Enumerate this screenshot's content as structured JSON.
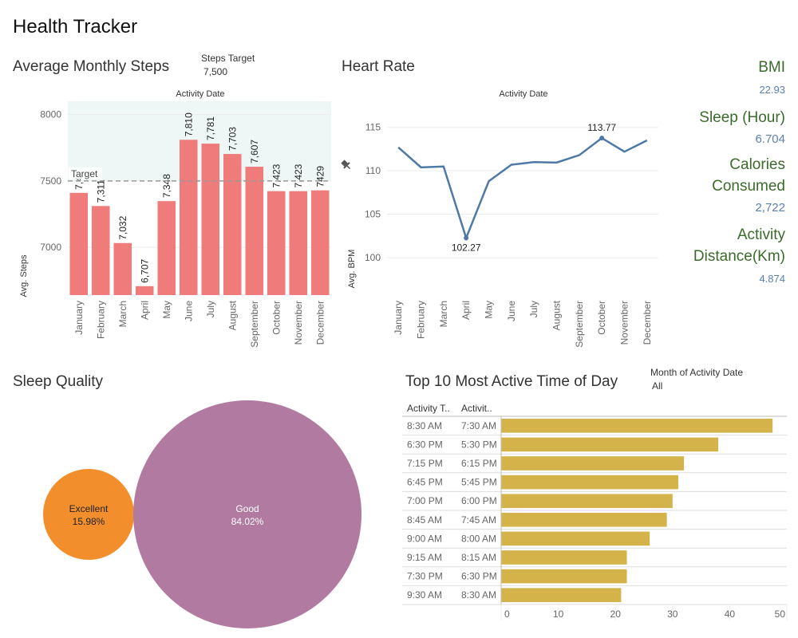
{
  "page_title": "Health Tracker",
  "steps": {
    "title": "Average Monthly Steps",
    "target_label": "Steps Target",
    "target_value": "7,500",
    "header": "Activity Date",
    "y_title": "Avg. Steps",
    "target_line_label": "Target",
    "bar_color": "#ef7b7b",
    "band_color": "#eef7f6"
  },
  "heart": {
    "title": "Heart Rate",
    "header": "Activity Date",
    "y_title": "Avg. BPM",
    "line_color": "#4e79a7"
  },
  "kpis": [
    {
      "label_lines": [
        "BMI"
      ],
      "value": "22.93"
    },
    {
      "label_lines": [
        "Sleep (Hour)"
      ],
      "value": "6.704"
    },
    {
      "label_lines": [
        "Calories",
        "Consumed"
      ],
      "value": "2,722"
    },
    {
      "label_lines": [
        "Activity",
        "Distance(Km)"
      ],
      "value": "4.874"
    }
  ],
  "sleep": {
    "title": "Sleep Quality",
    "circles": [
      {
        "label": "Excellent",
        "pct": "15.98%",
        "color": "#f28e2b"
      },
      {
        "label": "Good",
        "pct": "84.02%",
        "color": "#b07aa1"
      }
    ]
  },
  "active": {
    "title": "Top 10 Most Active Time of Day",
    "filter_label": "Month of Activity Date",
    "filter_value": "All",
    "col1": "Activity T..",
    "col2": "Activit..",
    "bar_color": "#d4b44a"
  },
  "chart_data": [
    {
      "type": "bar",
      "title": "Average Monthly Steps",
      "xlabel": "Activity Date",
      "ylabel": "Avg. Steps",
      "categories": [
        "January",
        "February",
        "March",
        "April",
        "May",
        "June",
        "July",
        "August",
        "September",
        "October",
        "November",
        "December"
      ],
      "values": [
        7410,
        7311,
        7032,
        6707,
        7348,
        7810,
        7781,
        7703,
        7607,
        7423,
        7423,
        7429
      ],
      "labels": [
        "7,4..",
        "7,311",
        "7,032",
        "6,707",
        "7,348",
        "7,810",
        "7,781",
        "7,703",
        "7,607",
        "7,423",
        "7,423",
        "7429"
      ],
      "yticks": [
        7000,
        7500,
        8000
      ],
      "ylim": [
        6640,
        8100
      ],
      "reference_line": 7500,
      "reference_band": [
        7500,
        8100
      ]
    },
    {
      "type": "line",
      "title": "Heart Rate",
      "xlabel": "Activity Date",
      "ylabel": "Avg. BPM",
      "categories": [
        "January",
        "February",
        "March",
        "April",
        "May",
        "June",
        "July",
        "August",
        "September",
        "October",
        "November",
        "December"
      ],
      "values": [
        112.7,
        110.4,
        110.5,
        102.27,
        108.8,
        110.7,
        111.0,
        110.95,
        111.8,
        113.77,
        112.2,
        113.5
      ],
      "annotations": [
        {
          "index": 3,
          "text": "102.27"
        },
        {
          "index": 9,
          "text": "113.77"
        }
      ],
      "yticks": [
        100,
        105,
        110,
        115
      ],
      "ylim": [
        95.7,
        118
      ]
    },
    {
      "type": "bar",
      "title": "Top 10 Most Active Time of Day",
      "orientation": "horizontal",
      "categories": [
        [
          "8:30 AM",
          "7:30 AM"
        ],
        [
          "6:30 PM",
          "5:30 PM"
        ],
        [
          "7:15 PM",
          "6:15 PM"
        ],
        [
          "6:45 PM",
          "5:45 PM"
        ],
        [
          "7:00 PM",
          "6:00 PM"
        ],
        [
          "8:45 AM",
          "7:45 AM"
        ],
        [
          "9:00 AM",
          "8:00 AM"
        ],
        [
          "9:15 AM",
          "8:15 AM"
        ],
        [
          "7:30 PM",
          "6:30 PM"
        ],
        [
          "9:30 AM",
          "8:30 AM"
        ]
      ],
      "values": [
        47.5,
        38,
        32,
        31,
        30,
        29,
        26,
        22,
        22,
        21
      ],
      "xticks": [
        0,
        10,
        20,
        30,
        40,
        50
      ],
      "xlim": [
        0,
        50
      ]
    },
    {
      "type": "bubble",
      "title": "Sleep Quality",
      "categories": [
        "Excellent",
        "Good"
      ],
      "values": [
        15.98,
        84.02
      ]
    }
  ]
}
